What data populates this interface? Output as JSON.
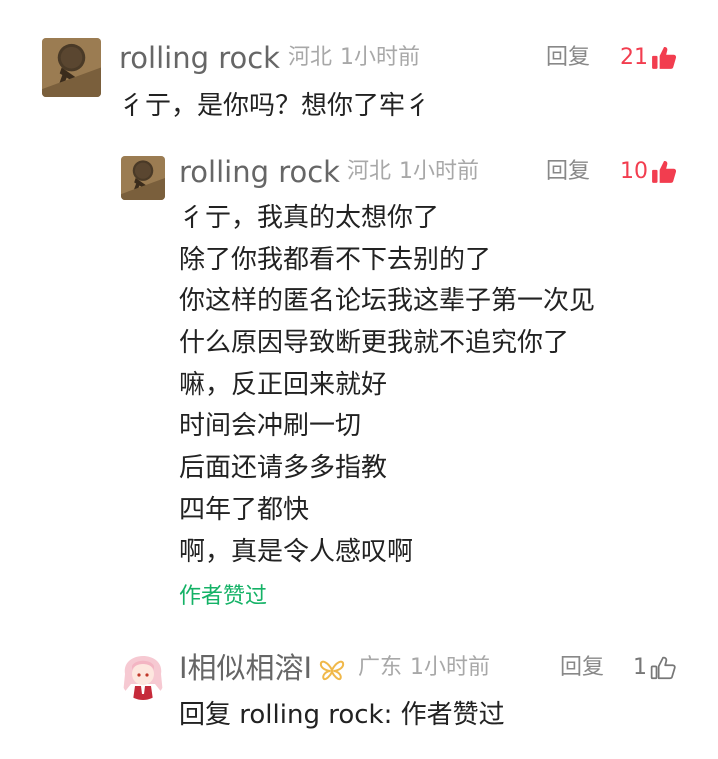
{
  "comments": [
    {
      "username": "rolling rock",
      "location": "河北",
      "time": "1小时前",
      "reply_label": "回复",
      "like_count": "21",
      "liked": true,
      "like_icon": "thumbs-up-filled-icon",
      "content": "彳亍，是你吗？想你了牢彳"
    },
    {
      "username": "rolling rock",
      "location": "河北",
      "time": "1小时前",
      "reply_label": "回复",
      "like_count": "10",
      "liked": true,
      "like_icon": "thumbs-up-filled-icon",
      "lines": [
        "彳亍，我真的太想你了",
        "除了你我都看不下去别的了",
        "你这样的匿名论坛我这辈子第一次见",
        "什么原因导致断更我就不追究你了",
        "嘛，反正回来就好",
        "时间会冲刷一切",
        "后面还请多多指教",
        "四年了都快",
        "啊，真是令人感叹啊"
      ],
      "author_liked_label": "作者赞过"
    },
    {
      "username": "I相似相溶I",
      "badge_icon": "butterfly-badge-icon",
      "location": "广东",
      "time": "1小时前",
      "reply_label": "回复",
      "like_count": "1",
      "liked": false,
      "like_icon": "thumbs-up-outline-icon",
      "reply_prefix": "回复",
      "reply_target": "rolling rock",
      "reply_separator": ":",
      "reply_text": "作者赞过"
    }
  ],
  "colors": {
    "like_active": "#f23d4f",
    "author_liked": "#14b266",
    "meta": "#a8a8a8",
    "username": "#666666",
    "badge": "#f0b84a"
  }
}
